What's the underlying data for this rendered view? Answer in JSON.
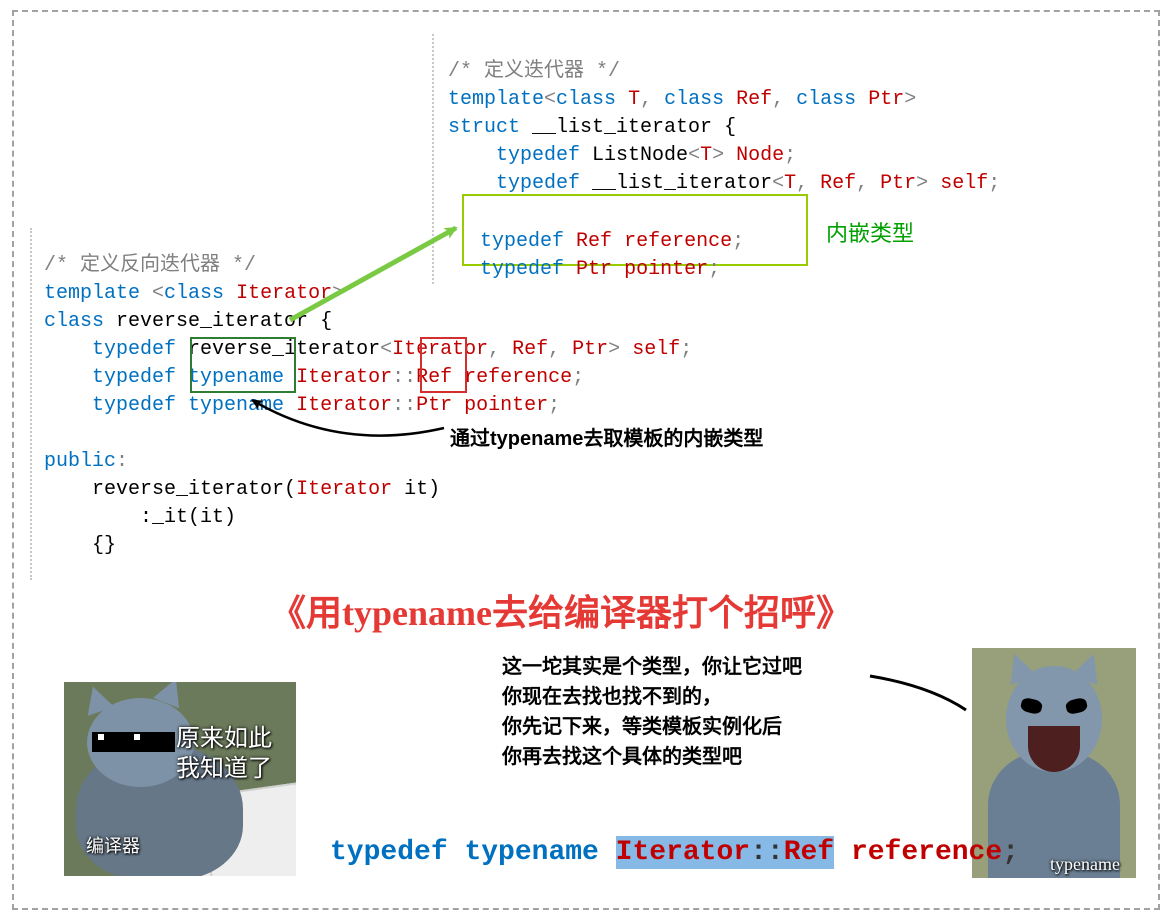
{
  "topCode": {
    "c1": "/* 定义迭代器 */",
    "l2a": "template",
    "l2b": "class",
    "l2c": "T",
    "l2d": "class",
    "l2e": "Ref",
    "l2f": "class",
    "l2g": "Ptr",
    "l3a": "struct",
    "l3b": "__list_iterator {",
    "l4a": "typedef",
    "l4b": "ListNode",
    "l4c": "T",
    "l4d": "Node",
    "l5a": "typedef",
    "l5b": "__list_iterator",
    "l5c": "T",
    "l5d": "Ref",
    "l5e": "Ptr",
    "l5f": "self",
    "l6a": "typedef",
    "l6b": "Ref",
    "l6c": "reference",
    "l7a": "typedef",
    "l7b": "Ptr",
    "l7c": "pointer"
  },
  "leftCode": {
    "c1": "/* 定义反向迭代器 */",
    "l2a": "template",
    "l2b": "class",
    "l2c": "Iterator",
    "l3a": "class",
    "l3b": "reverse_iterator {",
    "l4a": "typedef",
    "l4b": "reverse_iterator",
    "l4c": "Iterator",
    "l4d": "Ref",
    "l4e": "Ptr",
    "l4f": "self",
    "l5a": "typedef",
    "l5b": "typename",
    "l5c": "Iterator",
    "l5d": "Ref",
    "l5e": "reference",
    "l6a": "typedef",
    "l6b": "typename",
    "l6c": "Iterator",
    "l6d": "Ptr",
    "l6e": "pointer",
    "l7a": "public",
    "l8a": "reverse_iterator(",
    "l8b": "Iterator",
    "l8c": " it)",
    "l9a": ":_it(it)",
    "l10a": "{}"
  },
  "anno": {
    "nested": "内嵌类型",
    "viaTypename": "通过typename去取模板的内嵌类型",
    "title": "《用typename去给编译器打个招呼》",
    "memeLeft1": "原来如此",
    "memeLeft2": "我知道了",
    "memeLeftTag": "编译器",
    "speech": "这一坨其实是个类型，你让它过吧\n你现在去找也找不到的，\n你先记下来，等类模板实例化后\n你再去找这个具体的类型吧",
    "memeRightTag": "typename"
  },
  "bottomCode": {
    "a": "typedef",
    "b": "typename",
    "c": "Iterator",
    "d": "::",
    "e": "Ref",
    "f": "reference",
    "g": ";"
  }
}
